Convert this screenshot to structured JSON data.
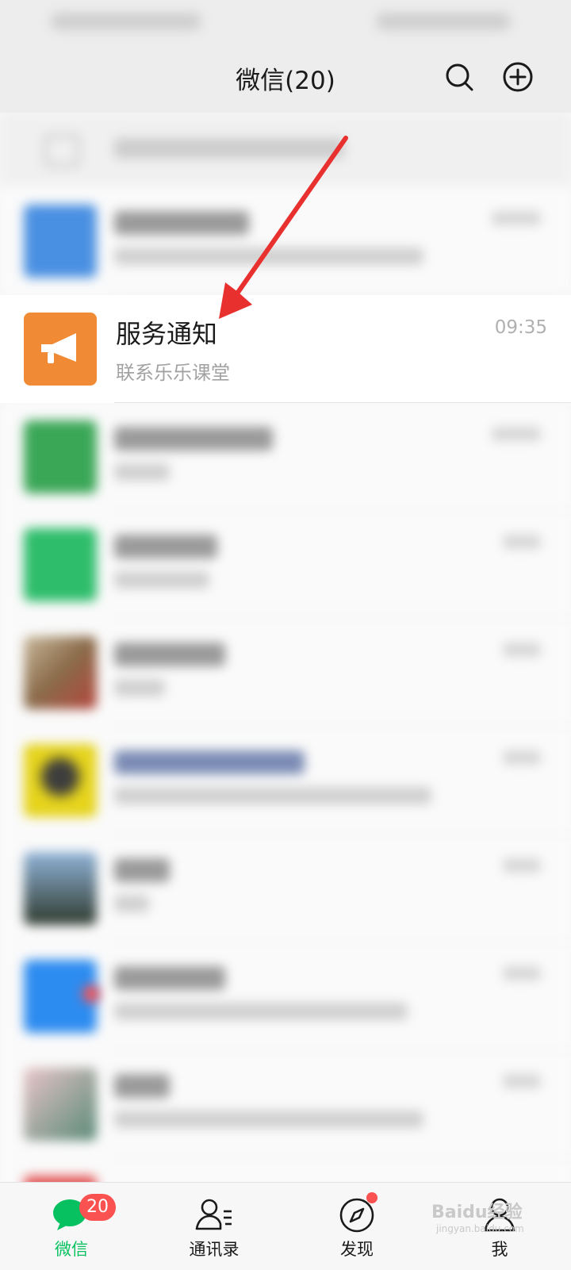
{
  "header": {
    "title": "微信(20)",
    "search_icon": "search-icon",
    "add_icon": "plus-circle-icon"
  },
  "focused_chat": {
    "name": "服务通知",
    "preview": "联系乐乐课堂",
    "time": "09:35",
    "avatar_color": "#f08a34",
    "avatar_icon": "megaphone-icon"
  },
  "tabbar": {
    "tabs": [
      {
        "label": "微信",
        "icon": "chat-bubble-icon",
        "active": true
      },
      {
        "label": "通讯录",
        "icon": "contacts-icon"
      },
      {
        "label": "发现",
        "icon": "compass-icon"
      },
      {
        "label": "我",
        "icon": "person-icon"
      }
    ],
    "chats_badge": "20"
  },
  "colors": {
    "accent": "#07c160",
    "badge": "#fa5151",
    "annotation_arrow": "#e8302f"
  },
  "watermark": {
    "text": "Baidu经验",
    "sub": "jingyan.baidu.com"
  }
}
